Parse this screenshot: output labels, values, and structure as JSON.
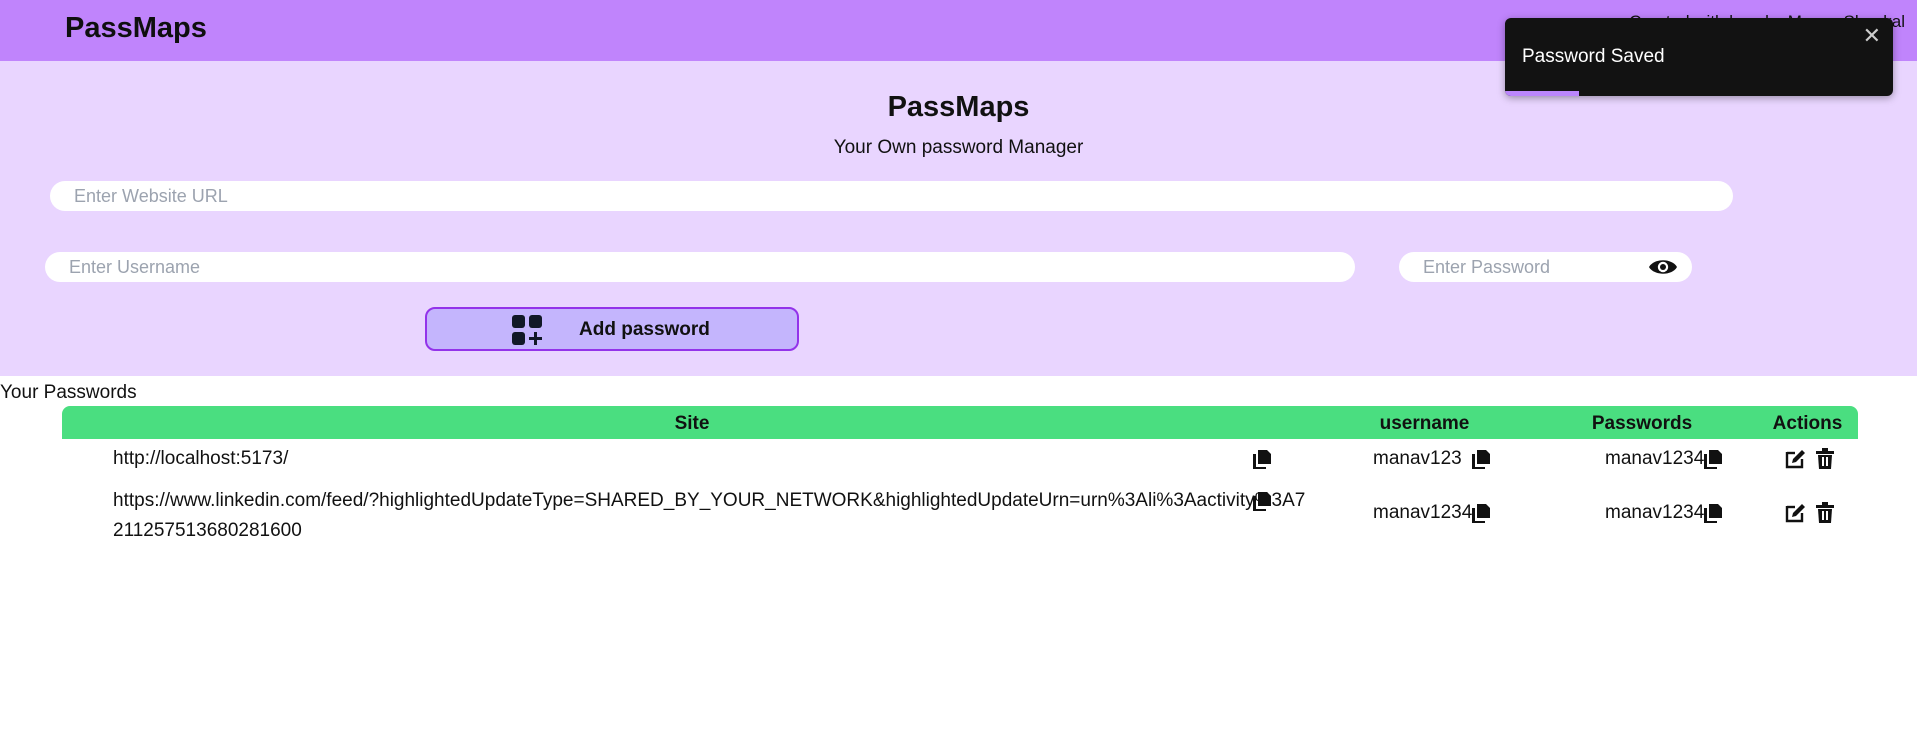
{
  "navbar": {
    "brand": "PassMaps",
    "tagline": "Created with love by Manav Shankal"
  },
  "form": {
    "title": "PassMaps",
    "subtitle": "Your Own password Manager",
    "url_placeholder": "Enter Website URL",
    "url_value": "",
    "username_placeholder": "Enter Username",
    "username_value": "",
    "password_placeholder": "Enter Password",
    "password_value": "",
    "add_button_label": "Add password",
    "add_icon": "add-grid-icon",
    "eye_icon": "eye-icon"
  },
  "toast": {
    "message": "Password Saved",
    "close_glyph": "✕",
    "progress": 0.19
  },
  "passwords": {
    "section_label": "Your Passwords",
    "headers": {
      "site": "Site",
      "username": "username",
      "password": "Passwords",
      "actions": "Actions"
    },
    "rows": [
      {
        "site": "http://localhost:5173/",
        "username": "manav123",
        "password": "manav1234"
      },
      {
        "site": "https://www.linkedin.com/feed/?highlightedUpdateType=SHARED_BY_YOUR_NETWORK&highlightedUpdateUrn=urn%3Ali%3Aactivity%3A7211257513680281600",
        "username": "manav1234",
        "password": "manav1234"
      }
    ]
  },
  "colors": {
    "navbar": "#c084fc",
    "panel": "#e9d5ff",
    "button": "#c4b5fd",
    "button_border": "#9333ea",
    "table_header": "#4ade80",
    "toast": "#121212",
    "toast_progress": "#bb86fc"
  }
}
